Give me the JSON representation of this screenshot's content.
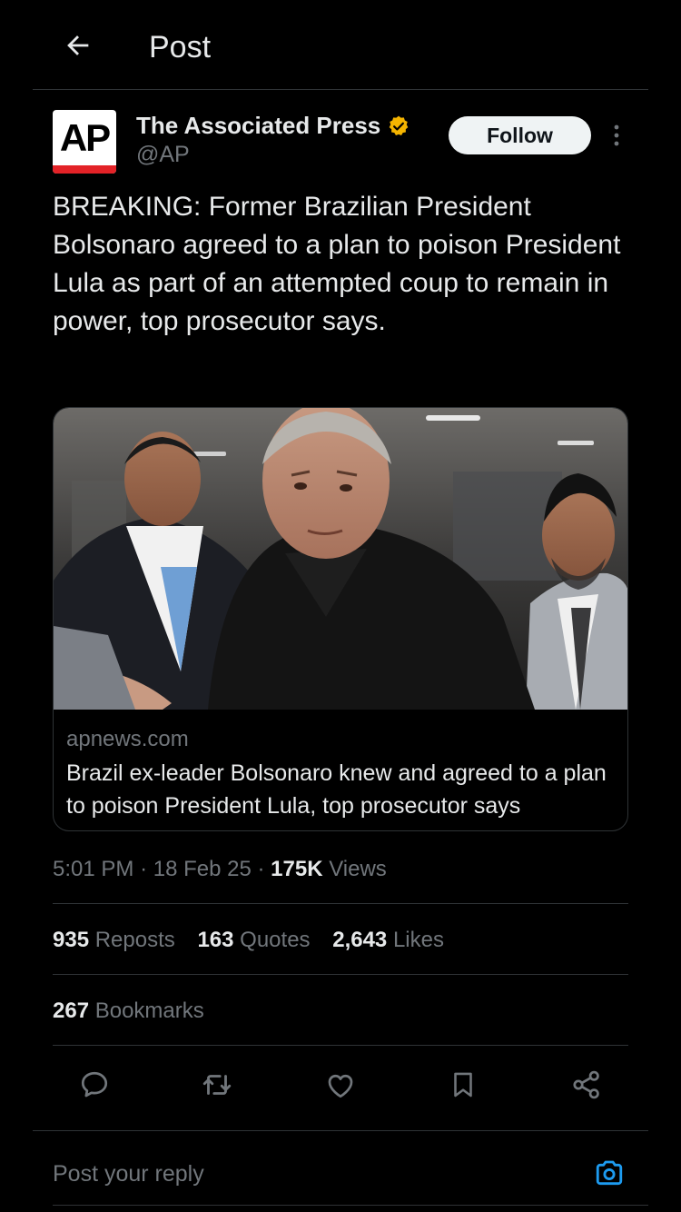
{
  "header": {
    "title": "Post",
    "back_icon": "arrow-left-icon"
  },
  "author": {
    "avatar_text": "AP",
    "name": "The Associated Press",
    "handle": "@AP",
    "verified_icon": "verified-badge-icon",
    "verified_color": "#f4b400"
  },
  "actions_top": {
    "follow_label": "Follow",
    "more_icon": "more-vertical-icon"
  },
  "tweet": {
    "text": "BREAKING: Former Brazilian President Bolsonaro agreed to a plan to poison President Lula as part of an attempted coup to remain in power, top prosecutor says."
  },
  "card": {
    "domain": "apnews.com",
    "title": "Brazil ex-leader Bolsonaro knew and agreed to a plan to poison President Lula, top prosecutor says"
  },
  "meta": {
    "time": "5:01 PM",
    "date": "18 Feb 25",
    "views_count": "175K",
    "views_label": "Views"
  },
  "stats": {
    "reposts_count": "935",
    "reposts_label": "Reposts",
    "quotes_count": "163",
    "quotes_label": "Quotes",
    "likes_count": "2,643",
    "likes_label": "Likes",
    "bookmarks_count": "267",
    "bookmarks_label": "Bookmarks"
  },
  "action_bar": [
    "reply-icon",
    "repost-icon",
    "like-icon",
    "bookmark-icon",
    "share-icon"
  ],
  "reply": {
    "placeholder": "Post your reply",
    "camera_icon": "camera-icon"
  },
  "colors": {
    "background": "#000000",
    "text": "#e7e9ea",
    "muted": "#71767b",
    "accent": "#1d9bf0",
    "divider": "#2f3336"
  }
}
